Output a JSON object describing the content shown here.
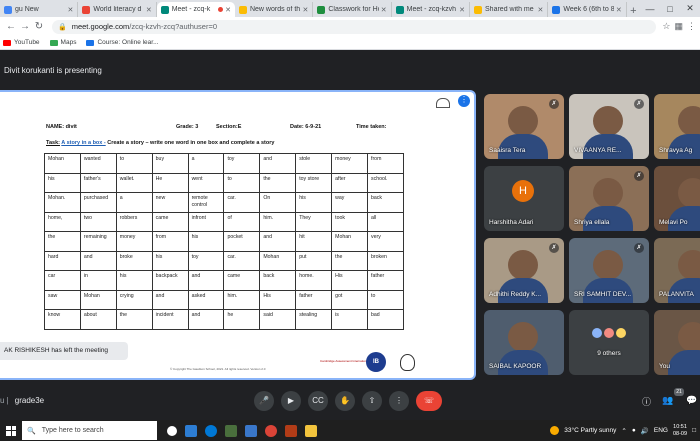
{
  "browser": {
    "tabs": [
      {
        "label": "gu New",
        "active": false,
        "favicon_color": "#4285f4"
      },
      {
        "label": "World literacy d",
        "active": false,
        "favicon_color": "#ea4335"
      },
      {
        "label": "Meet - zcq-k",
        "active": true,
        "favicon_color": "#00897b",
        "recording": true
      },
      {
        "label": "New words of the",
        "active": false,
        "favicon_color": "#fbbc04"
      },
      {
        "label": "Classwork for Ho",
        "active": false,
        "favicon_color": "#1e8e3e"
      },
      {
        "label": "Meet - zcq-kzvh",
        "active": false,
        "favicon_color": "#00897b"
      },
      {
        "label": "Shared with me",
        "active": false,
        "favicon_color": "#fbbc04"
      },
      {
        "label": "Week 6 (6th to 8",
        "active": false,
        "favicon_color": "#1a73e8"
      }
    ],
    "url_host": "meet.google.com",
    "url_path": "/zcq-kzvh-zcq?authuser=0",
    "bookmarks": [
      {
        "label": "YouTube",
        "color": "#ff0000"
      },
      {
        "label": "Maps",
        "color": "#34a853"
      },
      {
        "label": "Course: Online lear...",
        "color": "#1a73e8"
      }
    ]
  },
  "meet": {
    "presenter_text": "Divit korukanti is presenting",
    "meeting_code": "grade3e",
    "toast": "AK RISHIKESH has left the meeting",
    "self_name": "Divit Korukanti",
    "participant_count": "21",
    "participants": [
      {
        "name": "Saaisra Tera",
        "muted": true,
        "bg": "#b08a6a"
      },
      {
        "name": "VIVAANYA RE...",
        "muted": true,
        "bg": "#c9c4bc"
      },
      {
        "name": "Shravya Ag",
        "muted": true,
        "bg": "#a6875e"
      },
      {
        "name": "Harshitha Adari",
        "muted": false,
        "bg": "#3c4043",
        "avatar": "H"
      },
      {
        "name": "Shriya ellala",
        "muted": true,
        "bg": "#8b6f57"
      },
      {
        "name": "Melavi Po",
        "muted": true,
        "bg": "#6b4f3c"
      },
      {
        "name": "Adhithi Reddy K...",
        "muted": true,
        "bg": "#a99a86"
      },
      {
        "name": "SRI SAMHIT DEV...",
        "muted": true,
        "bg": "#5d6b7a"
      },
      {
        "name": "PALANVITA",
        "muted": true,
        "bg": "#7b6a55"
      },
      {
        "name": "SAIBAL KAPOOR",
        "muted": false,
        "bg": "#4f5d6e"
      },
      {
        "name": "9 others",
        "muted": false,
        "bg": "#3c4043"
      },
      {
        "name": "You",
        "muted": false,
        "bg": "#6a5646"
      }
    ]
  },
  "worksheet": {
    "name_label": "NAME:",
    "name_value": "divit",
    "grade_label": "Grade:",
    "grade_value": "3",
    "section_label": "Section:",
    "section_value": "E",
    "date_label": "Date:",
    "date_value": "6-9-21",
    "time_label": "Time taken:",
    "task_label": "Task:",
    "task_link": "A story in a box -",
    "task_text": "Create a story – write one word in one box and complete a story",
    "rows": [
      [
        "Mohan",
        "wanted",
        "to",
        "buy",
        "a",
        "toy",
        "and",
        "stole",
        "money",
        "from"
      ],
      [
        "his",
        "father's",
        "wallet.",
        "He",
        "went",
        "to",
        "the",
        "toy store",
        "after",
        "school."
      ],
      [
        "Mohan.",
        "purchased",
        "a",
        "new",
        "remote control",
        "car.",
        "On",
        "his",
        "way",
        "back"
      ],
      [
        "home,",
        "two",
        "robbers",
        "came",
        "infront",
        "of",
        "him.",
        "They",
        "took",
        "all"
      ],
      [
        "the",
        "remaining",
        "money",
        "from",
        "his",
        "pocket",
        "and",
        "hit",
        "Mohan",
        "very"
      ],
      [
        "hard",
        "and",
        "broke",
        "his",
        "toy",
        "car.",
        "Mohan",
        "put",
        "the",
        "broken"
      ],
      [
        "car",
        "in",
        "his",
        "backpack",
        "and",
        "came",
        "back",
        "home.",
        "His",
        "father"
      ],
      [
        "saw",
        "Mohan",
        "crying",
        "and",
        "asked",
        "him.",
        "His",
        "father",
        "got",
        "to"
      ],
      [
        "know",
        "about",
        "the",
        "incident",
        "and",
        "he",
        "said",
        "stealing",
        "is",
        "bad"
      ]
    ],
    "footer": "© Copyright The Gaudium School, 2021. All rights reserved. Version 2.0",
    "cambridge": "Cambridge Assessment International Education",
    "ib_badge": "IB"
  },
  "taskbar": {
    "search_placeholder": "Type here to search",
    "weather": "33°C Partly sunny",
    "language": "ENG",
    "time": "10:51",
    "date": "08-09"
  }
}
